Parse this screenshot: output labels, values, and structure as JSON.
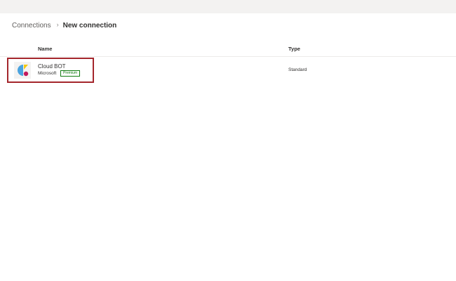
{
  "breadcrumb": {
    "parent": "Connections",
    "separator": "›",
    "current": "New connection"
  },
  "table": {
    "headers": {
      "name": "Name",
      "type": "Type"
    },
    "rows": [
      {
        "name": "Cloud BOT",
        "publisher": "Microsoft",
        "badge": "Premium",
        "type": "Standard",
        "icon": "cloud-bot-logo-icon"
      }
    ]
  },
  "colors": {
    "highlight": "#a4262c",
    "premium": "#107c10",
    "logo_blue": "#4aa3df",
    "logo_yellow": "#f2c811",
    "logo_magenta": "#c2185b"
  }
}
